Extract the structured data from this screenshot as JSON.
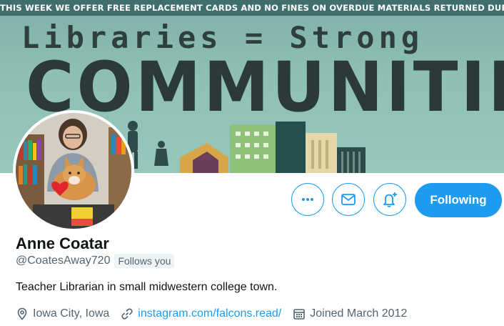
{
  "banner": {
    "top_text": "THIS WEEK WE OFFER FREE REPLACEMENT CARDS AND NO FINES ON OVERDUE MATERIALS RETURNED DURING THE WEEK.",
    "line1": "Libraries = Strong",
    "line2": "COMMUNITIES"
  },
  "profile": {
    "name": "Anne Coatar",
    "handle": "@CoatesAway720",
    "follows_badge": "Follows you",
    "bio": "Teacher Librarian in small midwestern college town.",
    "location": "Iowa City, Iowa",
    "website": "instagram.com/falcons.read/",
    "joined": "Joined March 2012"
  },
  "actions": {
    "more_icon": "more-icon",
    "message_icon": "mail-icon",
    "notify_icon": "bell-plus-icon",
    "following_label": "Following"
  },
  "colors": {
    "accent": "#1d9bf0",
    "secondary_text": "#536471",
    "badge_bg": "#eff3f4"
  }
}
